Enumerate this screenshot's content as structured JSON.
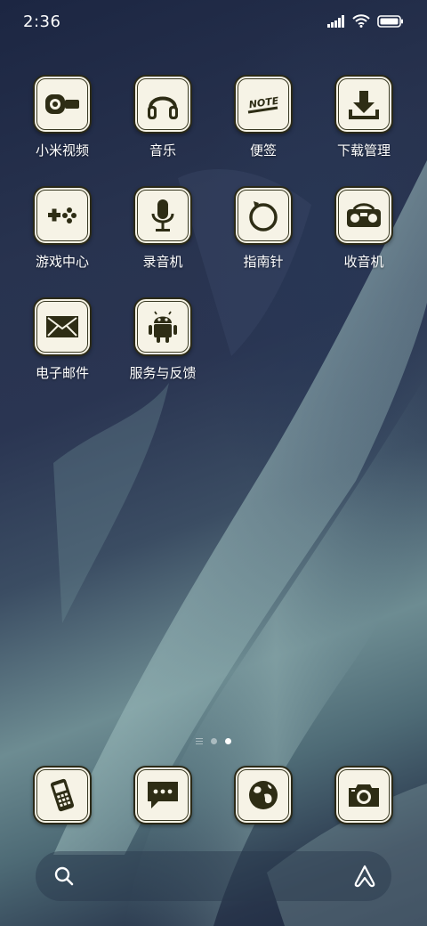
{
  "status_bar": {
    "time": "2:36",
    "icons": [
      "signal-icon",
      "wifi-icon",
      "battery-icon"
    ]
  },
  "apps": [
    {
      "label": "小米视频",
      "icon": "video-camera-icon"
    },
    {
      "label": "音乐",
      "icon": "headphones-icon"
    },
    {
      "label": "便签",
      "icon": "note-icon",
      "icon_text": "NOTE"
    },
    {
      "label": "下载管理",
      "icon": "download-icon"
    },
    {
      "label": "游戏中心",
      "icon": "gamepad-icon"
    },
    {
      "label": "录音机",
      "icon": "microphone-icon"
    },
    {
      "label": "指南针",
      "icon": "compass-icon"
    },
    {
      "label": "收音机",
      "icon": "radio-icon"
    },
    {
      "label": "电子邮件",
      "icon": "envelope-icon"
    },
    {
      "label": "服务与反馈",
      "icon": "android-icon"
    }
  ],
  "page_indicator": {
    "pages": 2,
    "active": 2
  },
  "dock": [
    {
      "icon": "phone-icon"
    },
    {
      "icon": "message-icon"
    },
    {
      "icon": "globe-icon"
    },
    {
      "icon": "camera-icon"
    }
  ],
  "search": {
    "icon": "search-icon",
    "assistant_icon": "assistant-icon"
  },
  "colors": {
    "tile_bg": "#f6f3e6",
    "icon_fg": "#2e2d15",
    "tile_border": "#2b2a18"
  }
}
